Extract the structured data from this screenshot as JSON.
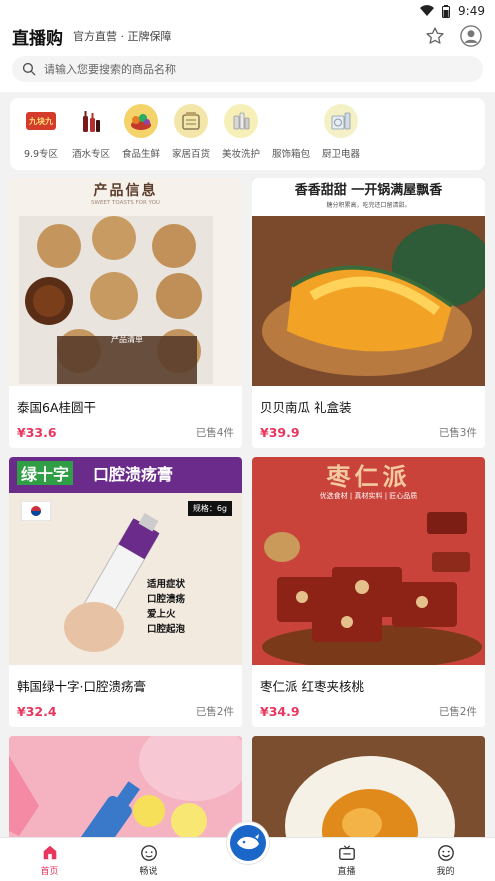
{
  "status": {
    "time": "9:49"
  },
  "header": {
    "title": "直播购",
    "subtitle": "官方直营 · 正牌保障"
  },
  "search": {
    "placeholder": "请输入您要搜索的商品名称"
  },
  "categories": [
    {
      "label": "9.9专区",
      "icon": "nine-nine-zone-icon",
      "color": "#d43b2a",
      "text": "九块九"
    },
    {
      "label": "酒水专区",
      "icon": "wine-bottles-icon",
      "color": "#7a1b1b",
      "text": ""
    },
    {
      "label": "食品生鲜",
      "icon": "fresh-food-icon",
      "color": "#f4d36b",
      "text": ""
    },
    {
      "label": "家居百货",
      "icon": "household-icon",
      "color": "#f3e6a8",
      "text": ""
    },
    {
      "label": "美妆洗护",
      "icon": "cosmetics-icon",
      "color": "#f6f0b8",
      "text": ""
    },
    {
      "label": "服饰箱包",
      "icon": "clothing-icon",
      "color": "#ffffff",
      "text": ""
    },
    {
      "label": "厨卫电器",
      "icon": "appliance-icon",
      "color": "#f4f1c6",
      "text": ""
    }
  ],
  "products": [
    {
      "name": "泰国6A桂圆干",
      "price": "¥33.6",
      "sold": "已售4件",
      "banner": "产品信息",
      "banner_sub": "SWEET TOASTS FOR YOU",
      "panel_title": "产品清单"
    },
    {
      "name": "贝贝南瓜 礼盒装",
      "price": "¥39.9",
      "sold": "已售3件",
      "banner": "香香甜甜 一开锅满屋飘香",
      "banner_sub": "糖分积累高，吃完还口留清甜。"
    },
    {
      "name": "韩国绿十字·口腔溃疡膏",
      "price": "¥32.4",
      "sold": "已售2件",
      "banner": "绿十字",
      "banner2": "口腔溃疡膏",
      "spec": "规格：6g",
      "features": [
        "适用症状",
        "口腔溃疡",
        "爱上火",
        "口腔起泡"
      ]
    },
    {
      "name": "枣仁派  红枣夹核桃",
      "price": "¥34.9",
      "sold": "已售2件",
      "banner": "枣仁派",
      "banner_sub": "优选食材 | 真材实料 | 匠心品质"
    }
  ],
  "tabs": [
    {
      "label": "首页",
      "icon": "home-icon"
    },
    {
      "label": "畅说",
      "icon": "chat-face-icon"
    },
    {
      "label": "",
      "icon": "whale-live-icon"
    },
    {
      "label": "直播",
      "icon": "live-tv-icon"
    },
    {
      "label": "我的",
      "icon": "profile-smile-icon"
    }
  ]
}
